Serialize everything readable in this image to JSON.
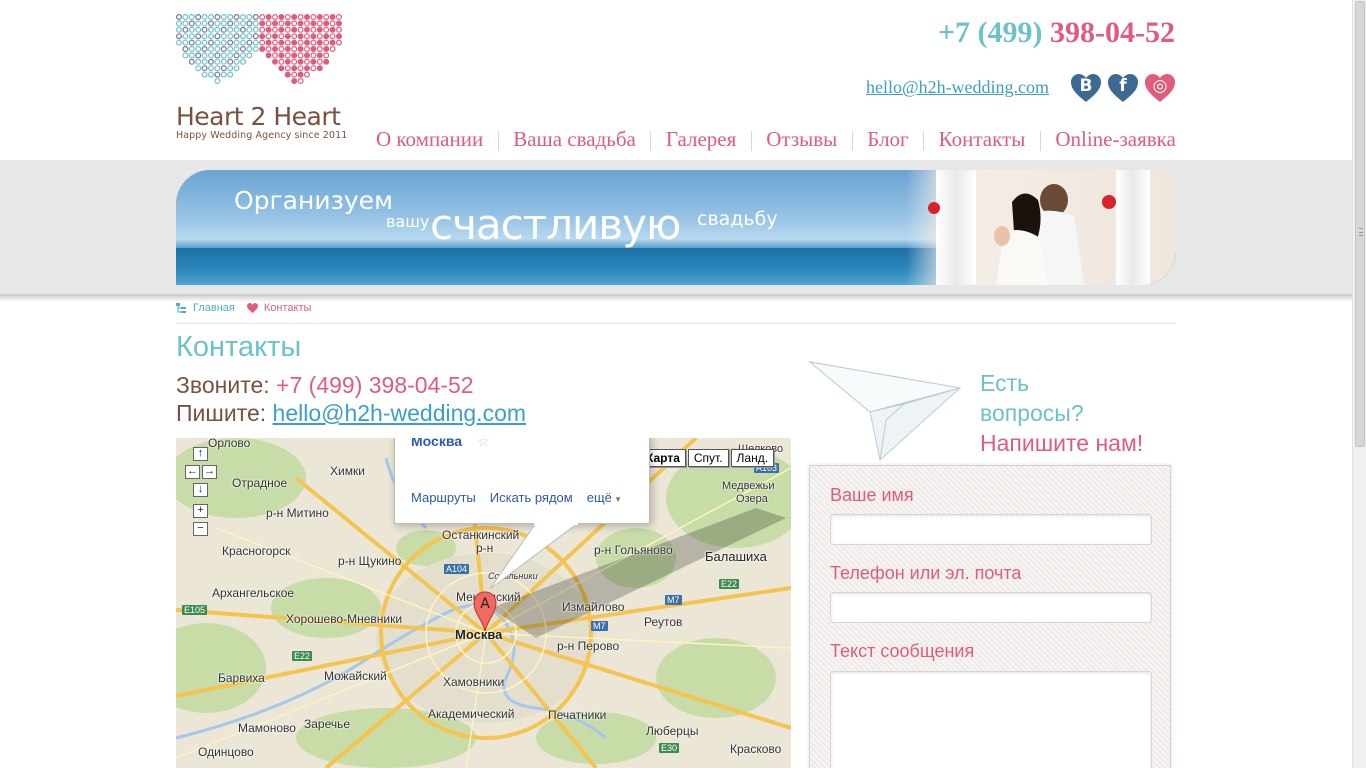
{
  "brand": {
    "name": "Heart 2 Heart",
    "tagline": "Happy Wedding Agency since 2011"
  },
  "header": {
    "phone_code": "+7 (499)",
    "phone_number": "398-04-52",
    "email": "hello@h2h-wedding.com",
    "social": [
      {
        "name": "vk-icon",
        "glyph": "B",
        "color": "#3d6a94"
      },
      {
        "name": "facebook-icon",
        "glyph": "f",
        "color": "#3d6a94"
      },
      {
        "name": "instagram-icon",
        "glyph": "◎",
        "color": "#e05c7c"
      }
    ]
  },
  "nav": {
    "items": [
      "О компании",
      "Ваша свадьба",
      "Галерея",
      "Отзывы",
      "Блог",
      "Контакты",
      "Online-заявка"
    ]
  },
  "banner": {
    "line1": "Организуем",
    "line2": "вашу",
    "line3": "счастливую",
    "line4": "свадьбу"
  },
  "breadcrumb": {
    "home": "Главная",
    "current": "Контакты"
  },
  "page": {
    "title": "Контакты",
    "call_label": "Звоните:",
    "call_value": "+7 (499) 398-04-52",
    "write_label": "Пишите:",
    "write_value": "hello@h2h-wedding.com"
  },
  "map": {
    "types": [
      "Карта",
      "Спут.",
      "Ланд."
    ],
    "active_type": "Карта",
    "bubble_title": "Москва",
    "bubble_links": [
      "Маршруты",
      "Искать рядом",
      "ещё"
    ],
    "labels": [
      {
        "t": "Орлово"
      },
      {
        "t": "Химки"
      },
      {
        "t": "Отрадное"
      },
      {
        "t": "р-н Митино"
      },
      {
        "t": "Красногорск"
      },
      {
        "t": "р-н Щукино"
      },
      {
        "t": "Архангельское"
      },
      {
        "t": "Хорошево-Мневники"
      },
      {
        "t": "Останкинский"
      },
      {
        "t": "р-н"
      },
      {
        "t": "р-н Гольяново"
      },
      {
        "t": "Балашиха"
      },
      {
        "t": "Мещанский"
      },
      {
        "t": "Измайлово"
      },
      {
        "t": "Реутов"
      },
      {
        "t": "Москва"
      },
      {
        "t": "р-н Перово"
      },
      {
        "t": "Барвиха"
      },
      {
        "t": "Можайский"
      },
      {
        "t": "Хамовники"
      },
      {
        "t": "Академический"
      },
      {
        "t": "Печатники"
      },
      {
        "t": "Люберцы"
      },
      {
        "t": "Мамоново"
      },
      {
        "t": "Заречье"
      },
      {
        "t": "Одинцово"
      },
      {
        "t": "Красково"
      },
      {
        "t": "Шелково"
      },
      {
        "t": "Медвежьи"
      },
      {
        "t": "Озера"
      },
      {
        "t": "Сокольники"
      }
    ],
    "roads": [
      "A104",
      "E22",
      "E105",
      "M7",
      "M7",
      "E22",
      "E30",
      "A103"
    ]
  },
  "contact_form": {
    "heading_1": "Есть",
    "heading_2": "вопросы?",
    "heading_3": "Напишите нам!",
    "name_label": "Ваше имя",
    "contact_label": "Телефон или эл. почта",
    "message_label": "Текст сообщения",
    "name_value": "",
    "contact_value": "",
    "message_value": ""
  }
}
